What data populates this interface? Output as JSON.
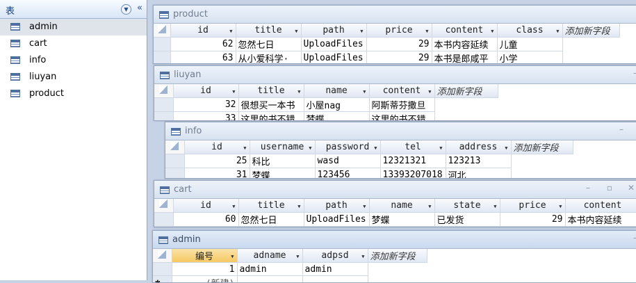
{
  "nav": {
    "title": "表",
    "items": [
      {
        "label": "admin",
        "selected": true
      },
      {
        "label": "cart"
      },
      {
        "label": "info"
      },
      {
        "label": "liuyan"
      },
      {
        "label": "product"
      }
    ]
  },
  "add_field_label": "添加新字段",
  "windows": {
    "product": {
      "title": "product",
      "columns": [
        "id",
        "title",
        "path",
        "price",
        "content",
        "class"
      ],
      "rows": [
        [
          "62",
          "忽然七日",
          "UploadFiles",
          "29",
          "本书内容延续",
          "儿童"
        ],
        [
          "63",
          "从小爱科学·",
          "UploadFiles",
          "29",
          "本书是郎咸平",
          "小学"
        ]
      ]
    },
    "liuyan": {
      "title": "liuyan",
      "columns": [
        "id",
        "title",
        "name",
        "content"
      ],
      "rows": [
        [
          "32",
          "很想买一本书",
          "小屋nag",
          "阿斯蒂芬撒旦"
        ],
        [
          "33",
          "这里的书不错",
          "梦蝶",
          "这里的书不错"
        ]
      ]
    },
    "info": {
      "title": "info",
      "columns": [
        "id",
        "username",
        "password",
        "tel",
        "address"
      ],
      "rows": [
        [
          "25",
          "科比",
          "wasd",
          "12321321",
          "123213"
        ],
        [
          "31",
          "梦蝶",
          "123456",
          "13393207018",
          "河北"
        ]
      ]
    },
    "cart": {
      "title": "cart",
      "columns": [
        "id",
        "title",
        "path",
        "name",
        "state",
        "price",
        "content"
      ],
      "rows": [
        [
          "60",
          "忽然七日",
          "UploadFiles",
          "梦蝶",
          "已发货",
          "29",
          "本书内容延续"
        ]
      ]
    },
    "admin": {
      "title": "admin",
      "columns": [
        "编号",
        "adname",
        "adpsd"
      ],
      "rows": [
        [
          "1",
          "admin",
          "admin"
        ]
      ],
      "new_row": "(新建)"
    }
  }
}
